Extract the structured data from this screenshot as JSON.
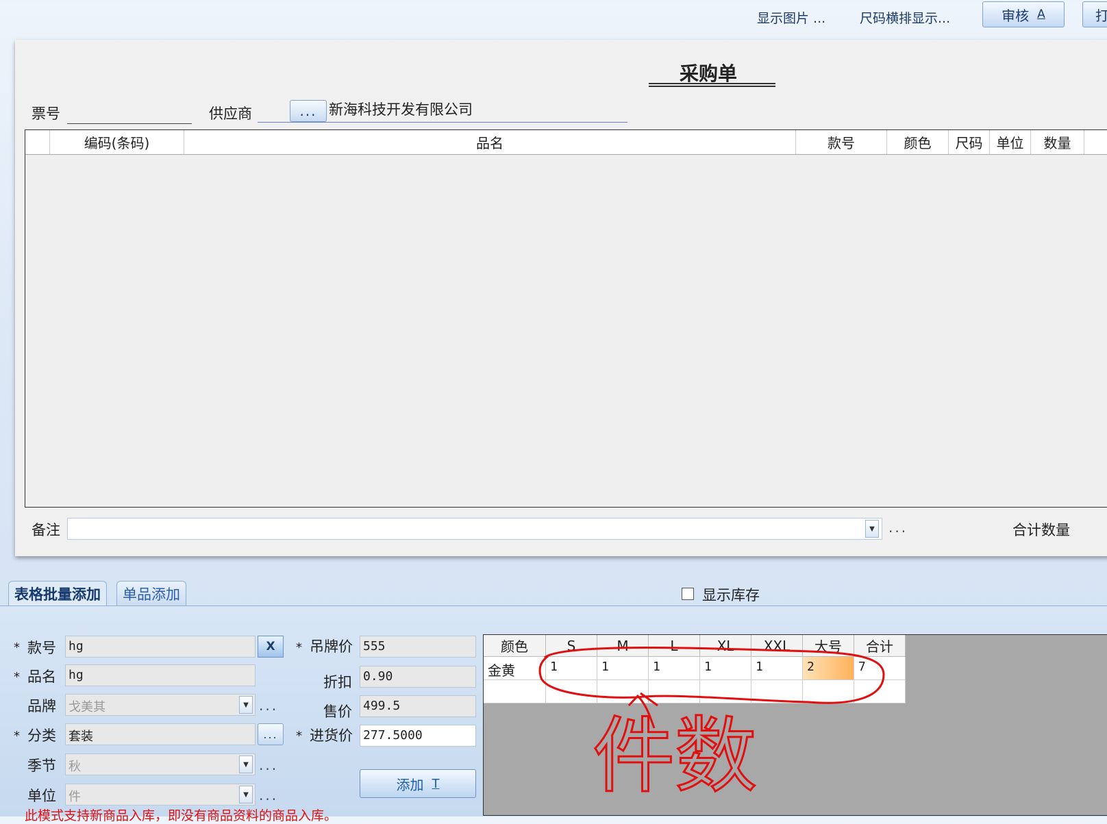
{
  "toolbar": {
    "show_image": "显示图片 ...",
    "size_horizontal": "尺码横排显示...",
    "audit_label": "审核",
    "audit_key": "A",
    "next_btn": "打"
  },
  "form": {
    "title": "采购单",
    "ticket_label": "票号",
    "ticket_value": "",
    "supplier_label": "供应商",
    "supplier_btn": "...",
    "supplier_value": "新海科技开发有限公司"
  },
  "grid": {
    "columns": [
      "编码(条码)",
      "品名",
      "款号",
      "颜色",
      "尺码",
      "单位",
      "数量"
    ]
  },
  "footer": {
    "remark_label": "备注",
    "remark_value": "",
    "remark_more": "...",
    "total_label": "合计数量"
  },
  "tabs": {
    "batch": "表格批量添加",
    "single": "单品添加",
    "show_stock": "显示库存"
  },
  "entry": {
    "style_label": "款号",
    "style_value": "hg",
    "clear_btn": "X",
    "name_label": "品名",
    "name_value": "hg",
    "brand_label": "品牌",
    "brand_value": "戈美其",
    "category_label": "分类",
    "category_value": "套装",
    "season_label": "季节",
    "season_value": "秋",
    "unit_label": "单位",
    "unit_value": "件",
    "tag_price_label": "吊牌价",
    "tag_price_value": "555",
    "discount_label": "折扣",
    "discount_value": "0.90",
    "sale_price_label": "售价",
    "sale_price_value": "499.5",
    "cost_label": "进货价",
    "cost_value": "277.5000",
    "add_label": "添加",
    "add_key": "T",
    "more": "...",
    "note": "此模式支持新商品入库，即没有商品资料的商品入库。"
  },
  "size_grid": {
    "headers": [
      "颜色",
      "S",
      "M",
      "L",
      "XL",
      "XXL",
      "大号",
      "合计"
    ],
    "row": [
      "金黄",
      "1",
      "1",
      "1",
      "1",
      "1",
      "2",
      "7"
    ]
  },
  "annotation": {
    "text": "件数",
    "color": "#e01010"
  }
}
